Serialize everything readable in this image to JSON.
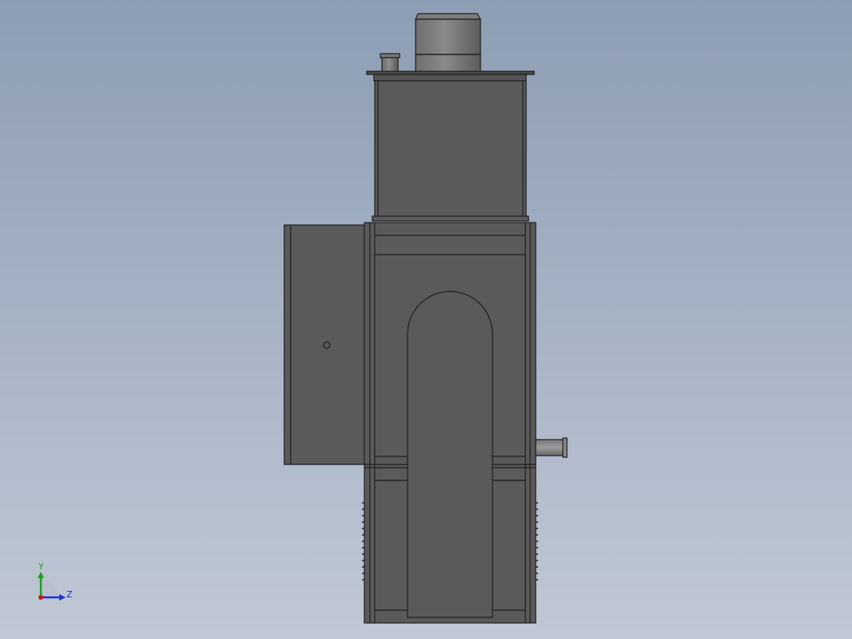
{
  "viewport": {
    "background_top": "#8d9db3",
    "background_bottom": "#c0c8d4",
    "model_fill": "#5a5a5a",
    "edge_color": "#1e1e1e"
  },
  "triad": {
    "y_label": "Y",
    "z_label": "Z",
    "y_color": "#1aa11a",
    "z_color": "#1d2fd6",
    "x_color": "#c81a1a"
  }
}
